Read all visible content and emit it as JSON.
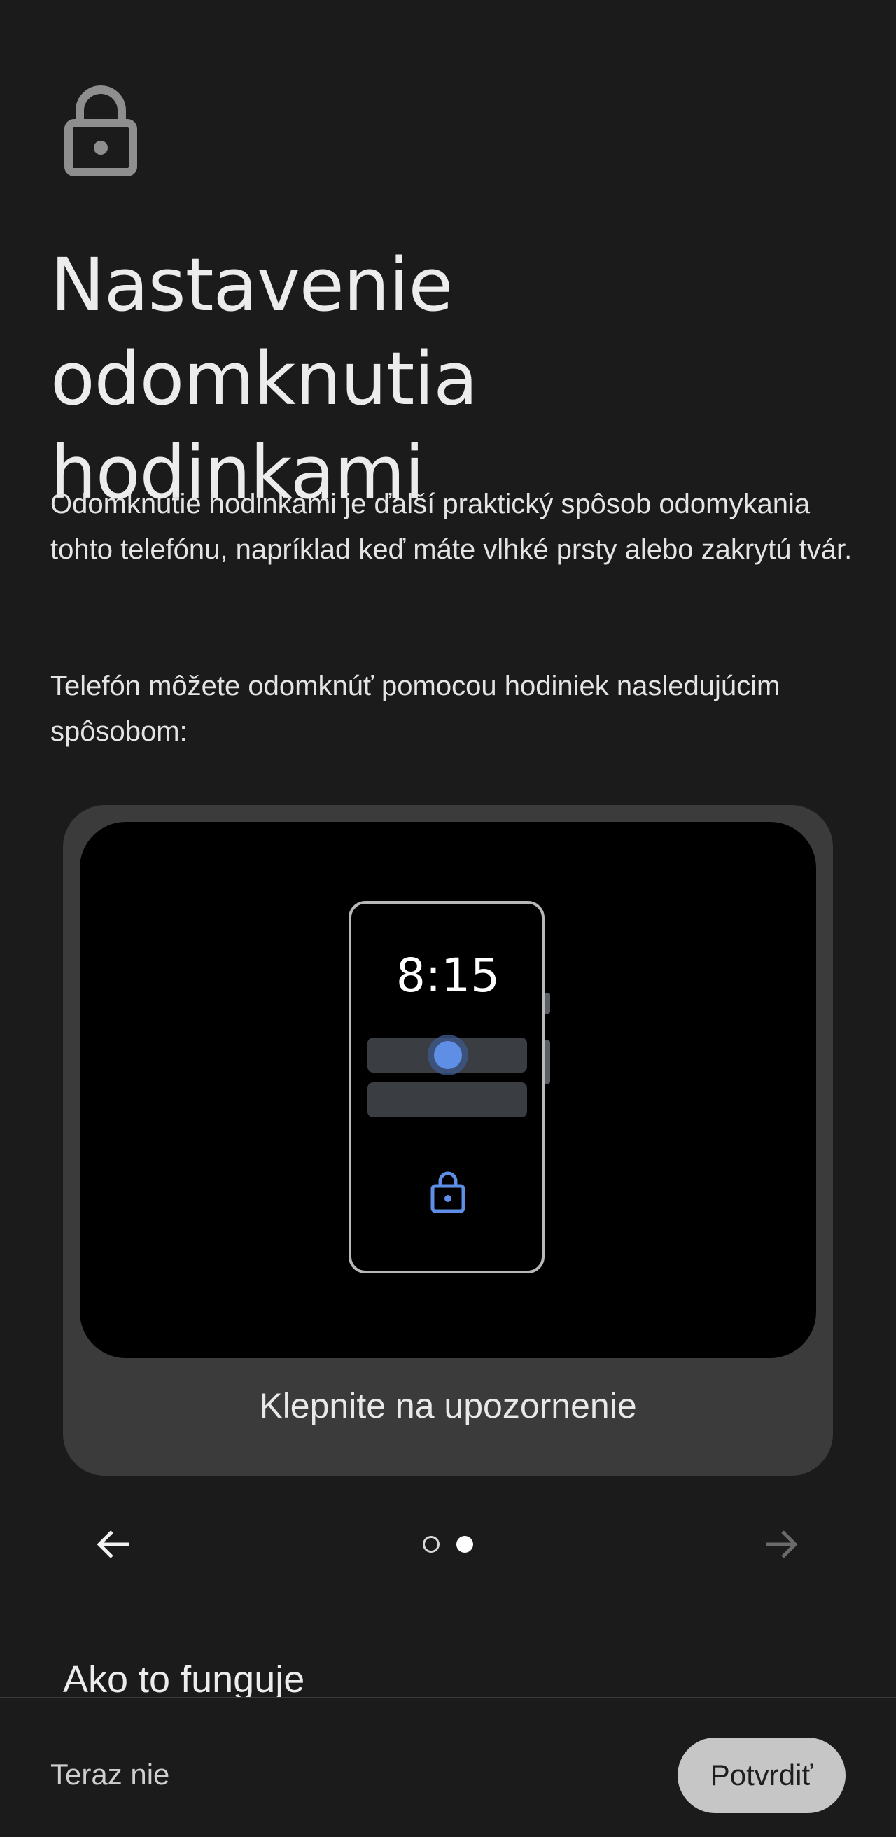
{
  "header": {
    "icon": "lock-icon",
    "title_line1": "Nastavenie",
    "title_line2": "odomknutia hodinkami"
  },
  "body": {
    "paragraph1": "Odomknutie hodinkami je ďalší praktický spôsob odomykania tohto telefónu, napríklad keď máte vlhké prsty alebo zakrytú tvár.",
    "paragraph2": "Telefón môžete odomknúť pomocou hodiniek nasledujúcim spôsobom:"
  },
  "illustration": {
    "time": "8:15",
    "caption": "Klepnite na upozornenie",
    "accent_color": "#5e8ee6",
    "frame_color": "#b8b8b8"
  },
  "pager": {
    "prev_icon": "arrow-left-icon",
    "next_icon": "arrow-right-icon",
    "current_page": 2,
    "total_pages": 2
  },
  "section": {
    "heading": "Ako to funguje"
  },
  "footer": {
    "skip_label": "Teraz nie",
    "confirm_label": "Potvrdiť"
  },
  "colors": {
    "background": "#1b1b1b",
    "card": "#3b3b3c",
    "button": "#c6c6c6"
  }
}
